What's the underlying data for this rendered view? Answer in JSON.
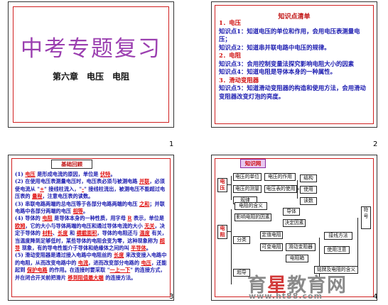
{
  "slides": {
    "s1": {
      "title": "中考专题复习",
      "subtitle": "第六章　电压　电阻",
      "number": "1"
    },
    "s2": {
      "header": "知识点清单",
      "number": "2",
      "lines": [
        {
          "prefix": "1．电压",
          "text": ""
        },
        {
          "prefix": "知识点1：",
          "text": "知道电压的单位和作用，会用电压表测量电压；"
        },
        {
          "prefix": "知识点2：",
          "text": "知道串并联电路中电压的规律。"
        },
        {
          "prefix": "2．电阻",
          "text": ""
        },
        {
          "prefix": "知识点3：",
          "text": "会用控制变量法探究影响电阻大小的因素"
        },
        {
          "prefix": "知识点4：",
          "text": "知道电阻是导体本身的一种属性。"
        },
        {
          "prefix": "3．滑动变阻器",
          "text": ""
        },
        {
          "prefix": "知识点5：",
          "text": "知道滑动变阻器的构造和使用方法，会用滑动变阻器改变灯泡的亮度。"
        }
      ]
    },
    "s3": {
      "header": "基础回顾",
      "number": "3",
      "paras": [
        [
          "(1) ",
          "电压",
          " 是形成电流的原因，单位是 ",
          "伏特",
          "。"
        ],
        [
          "(2) 在使用电压表测量电压时，电压表必须与被测电路 ",
          "并联",
          "，必须使电流从 \"",
          "+",
          "\" 接线柱流入，\"",
          "-",
          "\" 接线柱流出，被测电压不能超过电压表的 ",
          "量程",
          "，注意电压表的读数。"
        ],
        [
          "(3) 串联电路两端的总电压等于各部分电路两端的电压 ",
          "之和",
          "；并联电路中各部分两端的电压 ",
          "相等",
          "。"
        ],
        [
          "(4) 导体的 ",
          "电阻",
          " 是导体本身的一种性质，用字母 ",
          "R",
          " 表示，单位是 ",
          "欧姆",
          "，它的大小与导体两端的电压和通过导体电流的大小 ",
          "无关",
          "，决定于导体的 ",
          "材料",
          "、",
          "长度",
          " 和 ",
          "横截面积",
          "，导体的电阻还与 ",
          "温度",
          " 有关，当温度降到足够低时，某些导体的电阻会变为零，这种现象称为 ",
          "超导",
          " 现象，有的导电性能介于导体和绝缘体之间的叫 ",
          "半导体",
          "。"
        ],
        [
          "(5) 滑动变阻器是通过接入电路中电阻丝的 ",
          "长度",
          " 来改变接入电路中的电阻，从而改变电路中的 ",
          "电流",
          "，进而改变部分电路的 ",
          "电压",
          "，还能起到 ",
          "保护电路",
          " 的作用。在连接时要采取 \"",
          "一上一下",
          "\" 的连接方式，并在闭合开关前把滑片 ",
          "移到阻值最大端",
          " 的连接方法。"
        ]
      ]
    },
    "s4": {
      "header": "知识网",
      "number": "4",
      "left_label_1": "电压",
      "left_label_2": "电阻",
      "boxes": {
        "b1": "电压的作用",
        "b2": "电压的单位",
        "b3": "电压的测量",
        "b4": "电压表的使用",
        "b5": "规律",
        "b6": "电阻的含义",
        "b7": "影响电阻的因素",
        "b8": "结构",
        "b9": "使用",
        "b10": "读数",
        "b11": "超导",
        "b12": "分类",
        "b13": "定值电阻",
        "b14": "可变电阻",
        "b15": "滑动变阻器",
        "b16": "电阻箱",
        "b17": "导体",
        "b18": "决定因素",
        "b19": "接线方法",
        "b20": "使用注意",
        "b21": "符号",
        "b22": "铭牌及电阻的含义"
      }
    }
  },
  "watermark": {
    "brand_a": "育",
    "brand_star": "星",
    "brand_b": "教育网",
    "url": "www.ht88.com"
  }
}
